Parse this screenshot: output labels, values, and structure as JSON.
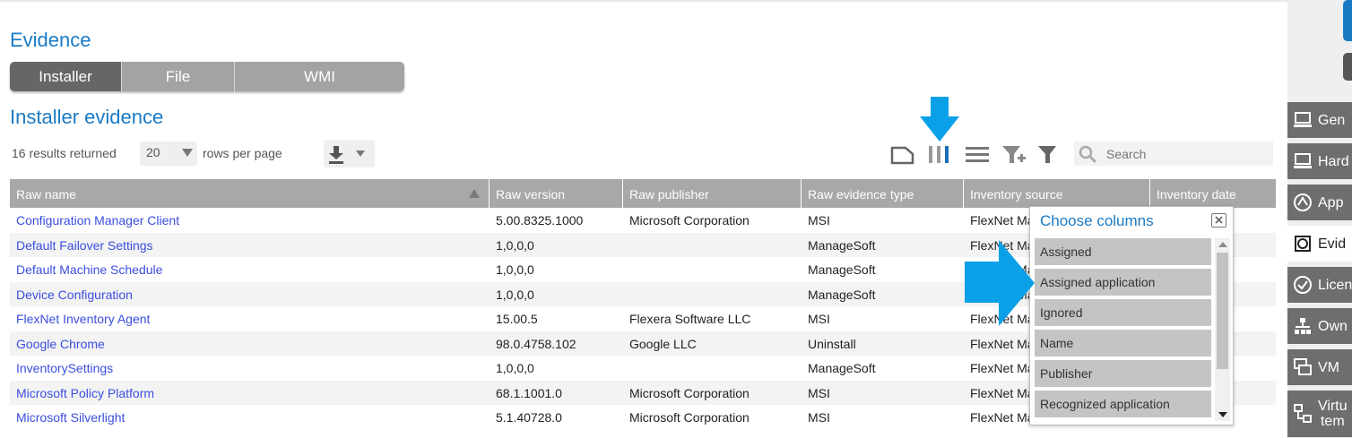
{
  "page": {
    "title": "Evidence",
    "section_title": "Installer evidence"
  },
  "tabs": [
    {
      "label": "Installer",
      "active": true
    },
    {
      "label": "File",
      "active": false
    },
    {
      "label": "WMI",
      "active": false
    }
  ],
  "pager": {
    "results_text": "16 results returned",
    "rows_value": "20",
    "rows_label": "rows per page"
  },
  "toolbar": {
    "search_placeholder": "Search"
  },
  "table": {
    "columns": [
      "Raw name",
      "Raw version",
      "Raw publisher",
      "Raw evidence type",
      "Inventory source",
      "Inventory date"
    ],
    "rows": [
      [
        "Configuration Manager Client",
        "5.00.8325.1000",
        "Microsoft Corporation",
        "MSI",
        "FlexNet Ma"
      ],
      [
        "Default Failover Settings",
        "1,0,0,0",
        "",
        "ManageSoft",
        "FlexNet Ma"
      ],
      [
        "Default Machine Schedule",
        "1,0,0,0",
        "",
        "ManageSoft",
        "FlexNet Ma"
      ],
      [
        "Device Configuration",
        "1,0,0,0",
        "",
        "ManageSoft",
        "FlexNet Ma"
      ],
      [
        "FlexNet Inventory Agent",
        "15.00.5",
        "Flexera Software LLC",
        "MSI",
        "FlexNet Ma"
      ],
      [
        "Google Chrome",
        "98.0.4758.102",
        "Google LLC",
        "Uninstall",
        "FlexNet Ma"
      ],
      [
        "InventorySettings",
        "1,0,0,0",
        "",
        "ManageSoft",
        "FlexNet Ma"
      ],
      [
        "Microsoft Policy Platform",
        "68.1.1001.0",
        "Microsoft Corporation",
        "MSI",
        "FlexNet Ma"
      ],
      [
        "Microsoft Silverlight",
        "5.1.40728.0",
        "Microsoft Corporation",
        "MSI",
        "FlexNet Ma"
      ]
    ]
  },
  "column_chooser": {
    "title": "Choose columns",
    "items": [
      "Assigned",
      "Assigned application",
      "Ignored",
      "Name",
      "Publisher",
      "Recognized application"
    ]
  },
  "sidebar": {
    "items": [
      {
        "label": "Gen",
        "icon": "computer-icon",
        "active": false
      },
      {
        "label": "Hard",
        "icon": "computer-icon",
        "active": false
      },
      {
        "label": "App",
        "icon": "application-icon",
        "active": false
      },
      {
        "label": "Evid",
        "icon": "evidence-icon",
        "active": true
      },
      {
        "label": "Licen",
        "icon": "license-icon",
        "active": false
      },
      {
        "label": "Own",
        "icon": "ownership-icon",
        "active": false
      },
      {
        "label": "VM",
        "icon": "vm-icon",
        "active": false
      },
      {
        "label": "Virtu\ntem",
        "icon": "virtual-template-icon",
        "active": false
      }
    ]
  },
  "colors": {
    "accent": "#1a7ac4",
    "link": "#3a4ee0",
    "highlight_arrow": "#0aa0e8",
    "header_gray": "#a8a8a8"
  }
}
